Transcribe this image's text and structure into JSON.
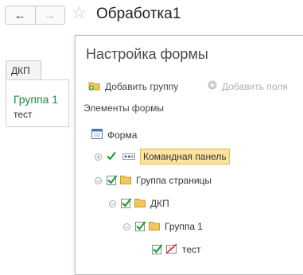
{
  "window": {
    "title": "Обработка1"
  },
  "nav": {
    "back_glyph": "←",
    "forward_glyph": "→",
    "star_glyph": "☆"
  },
  "left_form": {
    "tab_label": "ДКП",
    "group_title": "Группа 1",
    "field_text": "тест"
  },
  "dialog": {
    "title": "Настройка формы",
    "add_group_label": "Добавить группу",
    "add_fields_label": "Добавить поля",
    "elements_label": "Элементы формы"
  },
  "tree": {
    "form": "Форма",
    "command_bar": "Командная панель",
    "page_group": "Группа страницы",
    "dkp": "ДКП",
    "group1": "Группа 1",
    "test": "тест"
  },
  "colors": {
    "accent_green": "#1b8a3b",
    "highlight": "#fde2a0",
    "folder": "#f0c75e"
  }
}
